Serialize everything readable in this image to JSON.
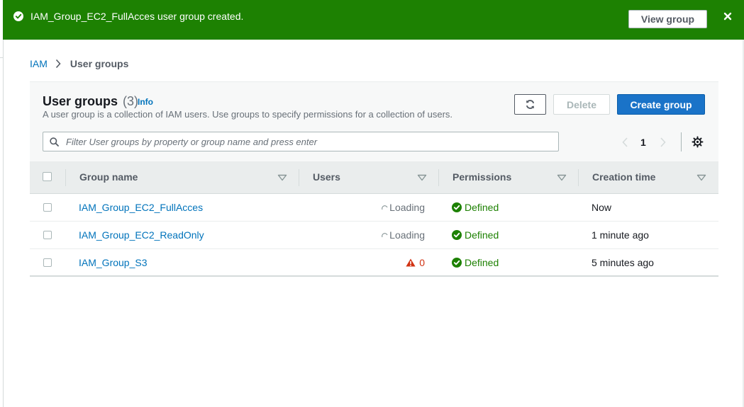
{
  "flash": {
    "message": "IAM_Group_EC2_FullAcces user group created.",
    "view_button": "View group",
    "color": "#1d8102"
  },
  "breadcrumb": {
    "root": "IAM",
    "current": "User groups"
  },
  "panel": {
    "title": "User groups",
    "count": "(3)",
    "info": "Info",
    "description": "A user group is a collection of IAM users. Use groups to specify permissions for a collection of users.",
    "refresh_icon": "refresh-icon",
    "delete_label": "Delete",
    "create_label": "Create group",
    "accent": "#1a73c8"
  },
  "filter": {
    "placeholder": "Filter User groups by property or group name and press enter",
    "value": ""
  },
  "pagination": {
    "current_page": "1"
  },
  "table": {
    "columns": [
      "Group name",
      "Users",
      "Permissions",
      "Creation time"
    ],
    "rows": [
      {
        "name": "IAM_Group_EC2_FullAcces",
        "users": "Loading",
        "users_state": "loading",
        "permissions": "Defined",
        "creation_time": "Now"
      },
      {
        "name": "IAM_Group_EC2_ReadOnly",
        "users": "Loading",
        "users_state": "loading",
        "permissions": "Defined",
        "creation_time": "1 minute ago"
      },
      {
        "name": "IAM_Group_S3",
        "users": "0",
        "users_state": "warning",
        "permissions": "Defined",
        "creation_time": "5 minutes ago"
      }
    ]
  }
}
